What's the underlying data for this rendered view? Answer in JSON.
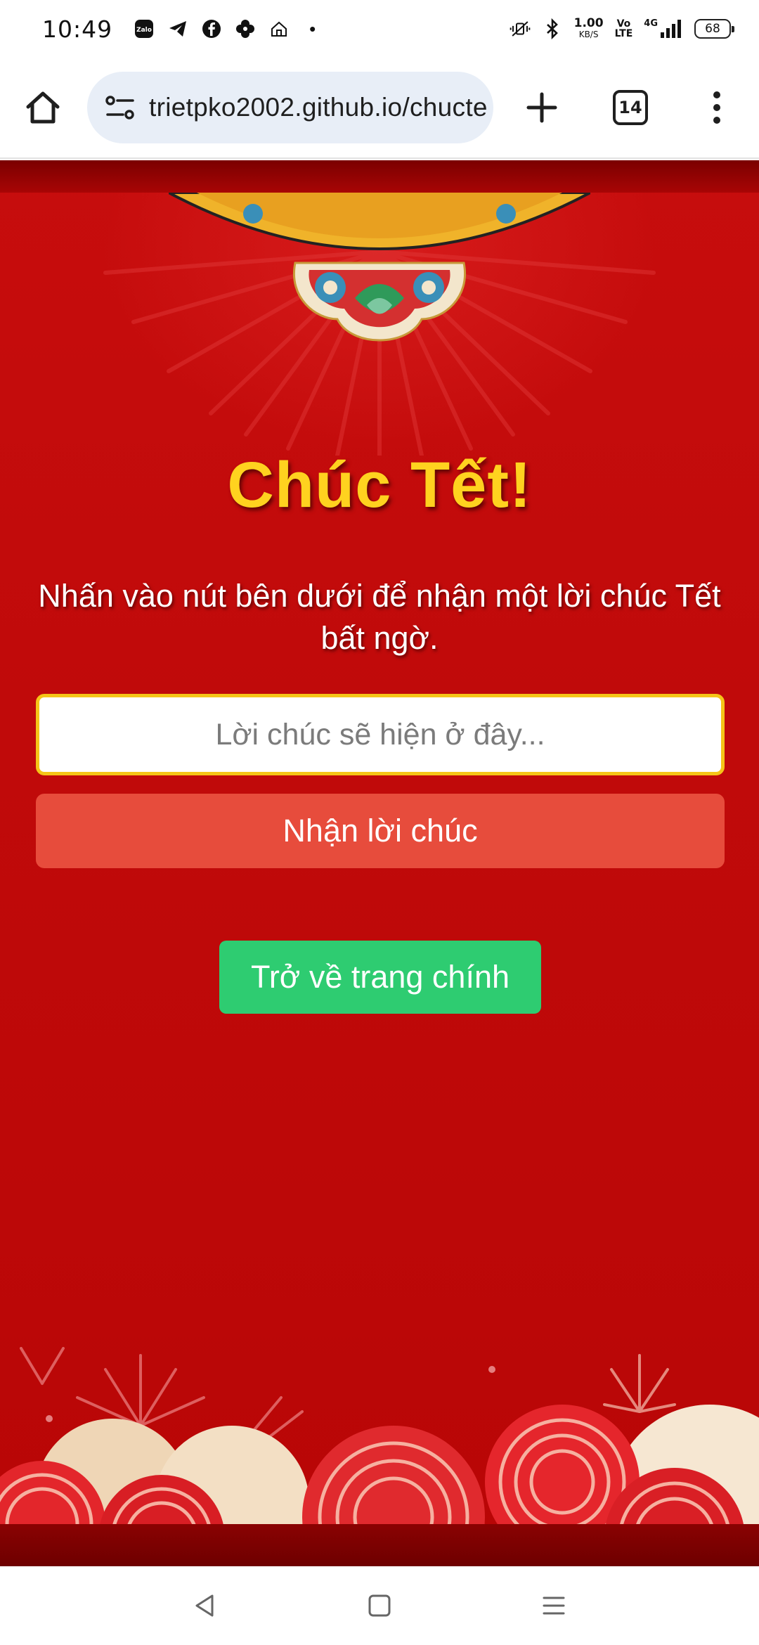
{
  "status_bar": {
    "time": "10:49",
    "app_icons": [
      "zalo-icon",
      "telegram-icon",
      "facebook-icon",
      "flower-app-icon",
      "home-app-icon"
    ],
    "more_dot": "•",
    "net_speed_value": "1.00",
    "net_speed_unit": "KB/S",
    "volte_line1": "Vo",
    "volte_line2": "LTE",
    "network_type": "4G",
    "battery_level": "68"
  },
  "browser": {
    "url": "trietpko2002.github.io/chucte",
    "tab_count": "14"
  },
  "page": {
    "title": "Chúc Tết!",
    "description": "Nhấn vào nút bên dưới để nhận một lời chúc Tết bất ngờ.",
    "wish_input_placeholder": "Lời chúc sẽ hiện ở đây...",
    "wish_input_value": "",
    "get_wish_label": "Nhận lời chúc",
    "back_home_label": "Trở về trang chính"
  },
  "colors": {
    "background_red": "#c00a0a",
    "title_gold": "#ffd21f",
    "input_border": "#f5c518",
    "get_wish_button": "#e74c3c",
    "back_home_button": "#2ecc71"
  }
}
